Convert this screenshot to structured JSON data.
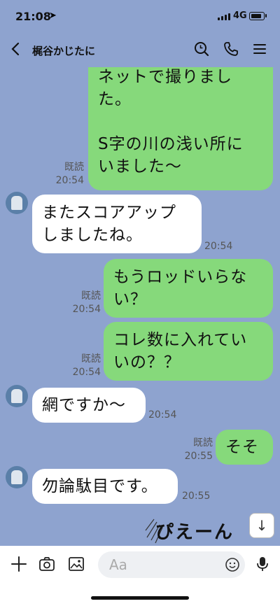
{
  "status": {
    "time": "21:08",
    "network": "4G"
  },
  "header": {
    "title": "梶谷かじたに"
  },
  "messages": [
    {
      "lines": [
        "ネットで撮りまし",
        "た。",
        "",
        "S字の川の浅い所に",
        "いました〜"
      ],
      "read": "既読",
      "time": "20:54"
    },
    {
      "lines": [
        "またスコアアップ",
        "しましたね。"
      ],
      "time": "20:54"
    },
    {
      "lines": [
        "もうロッドいらな",
        "い？"
      ],
      "read": "既読",
      "time": "20:54"
    },
    {
      "lines": [
        "コレ数に入れてい",
        "いの？？"
      ],
      "read": "既読",
      "time": "20:54"
    },
    {
      "lines": [
        "網ですか〜"
      ],
      "time": "20:54"
    },
    {
      "lines": [
        "そそ"
      ],
      "read": "既読",
      "time": "20:55"
    },
    {
      "lines": [
        "勿論駄目です。"
      ],
      "time": "20:55"
    }
  ],
  "sticker": {
    "text": "ぴえーん"
  },
  "input": {
    "placeholder": "Aa"
  },
  "icons": [
    "back-chevron",
    "search",
    "phone",
    "menu",
    "plus",
    "camera",
    "image",
    "emoji",
    "mic",
    "arrow-down"
  ]
}
